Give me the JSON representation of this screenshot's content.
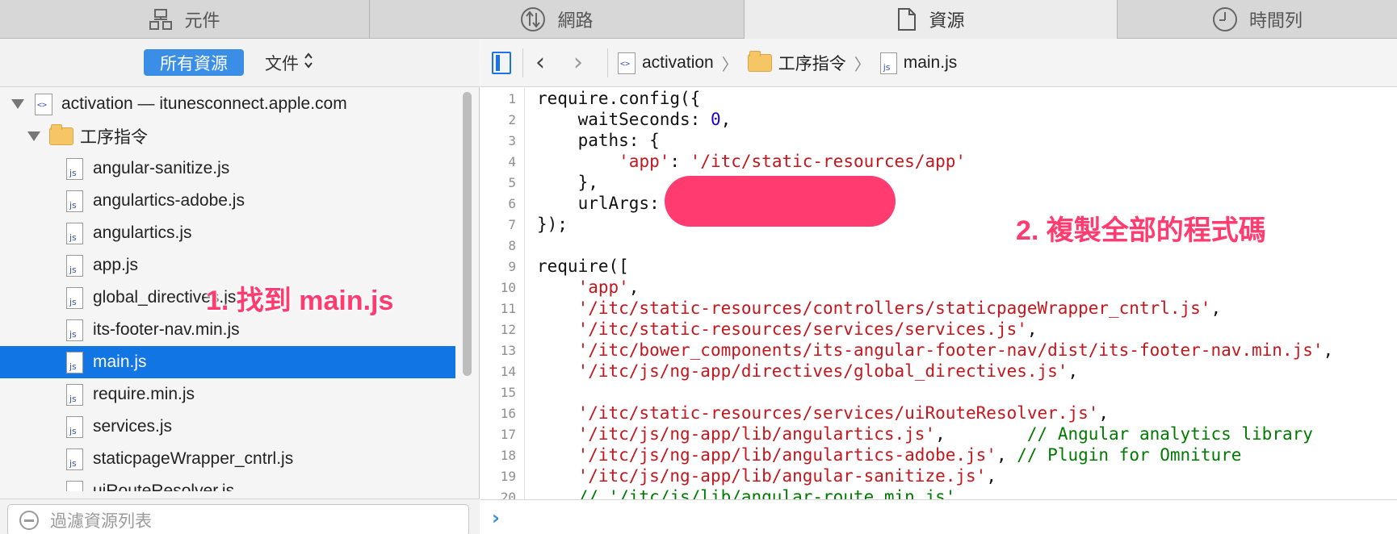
{
  "tabs": [
    {
      "label": "元件",
      "icon": "elements-icon"
    },
    {
      "label": "網路",
      "icon": "network-icon"
    },
    {
      "label": "資源",
      "icon": "resources-icon"
    },
    {
      "label": "時間列",
      "icon": "timelines-icon"
    }
  ],
  "sidebar": {
    "all_resources_label": "所有資源",
    "documents_label": "文件",
    "tree": {
      "root": "activation — itunesconnect.apple.com",
      "folder": "工序指令",
      "files": [
        "angular-sanitize.js",
        "angulartics-adobe.js",
        "angulartics.js",
        "app.js",
        "global_directives.js",
        "its-footer-nav.min.js",
        "main.js",
        "require.min.js",
        "services.js",
        "staticpageWrapper_cntrl.js",
        "uiRouteResolver.js"
      ],
      "file_icon_text": "js",
      "doc_icon_text": "<>"
    },
    "filter_placeholder": "過濾資源列表"
  },
  "editor": {
    "breadcrumb": [
      "activation",
      "工序指令",
      "main.js"
    ],
    "nav_back": "‹",
    "nav_forward": "›",
    "breadcrumb_sep": "〉",
    "console_prompt": "›",
    "code_lines": [
      {
        "n": "1",
        "parts": [
          {
            "t": "require.config({",
            "c": ""
          }
        ]
      },
      {
        "n": "2",
        "parts": [
          {
            "t": "    waitSeconds: ",
            "c": ""
          },
          {
            "t": "0",
            "c": "num"
          },
          {
            "t": ",",
            "c": ""
          }
        ]
      },
      {
        "n": "3",
        "parts": [
          {
            "t": "    paths: {",
            "c": ""
          }
        ]
      },
      {
        "n": "4",
        "parts": [
          {
            "t": "        ",
            "c": ""
          },
          {
            "t": "'app'",
            "c": "str"
          },
          {
            "t": ": ",
            "c": ""
          },
          {
            "t": "'/itc/static-resources/app'",
            "c": "str"
          }
        ]
      },
      {
        "n": "5",
        "parts": [
          {
            "t": "    },",
            "c": ""
          }
        ]
      },
      {
        "n": "6",
        "parts": [
          {
            "t": "    urlArgs:",
            "c": ""
          }
        ]
      },
      {
        "n": "7",
        "parts": [
          {
            "t": "});",
            "c": ""
          }
        ]
      },
      {
        "n": "8",
        "parts": [
          {
            "t": "",
            "c": ""
          }
        ]
      },
      {
        "n": "9",
        "parts": [
          {
            "t": "require([",
            "c": ""
          }
        ]
      },
      {
        "n": "10",
        "parts": [
          {
            "t": "    ",
            "c": ""
          },
          {
            "t": "'app'",
            "c": "str"
          },
          {
            "t": ",",
            "c": ""
          }
        ]
      },
      {
        "n": "11",
        "parts": [
          {
            "t": "    ",
            "c": ""
          },
          {
            "t": "'/itc/static-resources/controllers/staticpageWrapper_cntrl.js'",
            "c": "str"
          },
          {
            "t": ",",
            "c": ""
          }
        ]
      },
      {
        "n": "12",
        "parts": [
          {
            "t": "    ",
            "c": ""
          },
          {
            "t": "'/itc/static-resources/services/services.js'",
            "c": "str"
          },
          {
            "t": ",",
            "c": ""
          }
        ]
      },
      {
        "n": "13",
        "parts": [
          {
            "t": "    ",
            "c": ""
          },
          {
            "t": "'/itc/bower_components/its-angular-footer-nav/dist/its-footer-nav.min.js'",
            "c": "str"
          },
          {
            "t": ",",
            "c": ""
          }
        ]
      },
      {
        "n": "14",
        "parts": [
          {
            "t": "    ",
            "c": ""
          },
          {
            "t": "'/itc/js/ng-app/directives/global_directives.js'",
            "c": "str"
          },
          {
            "t": ",",
            "c": ""
          }
        ]
      },
      {
        "n": "15",
        "parts": [
          {
            "t": "",
            "c": ""
          }
        ]
      },
      {
        "n": "16",
        "parts": [
          {
            "t": "    ",
            "c": ""
          },
          {
            "t": "'/itc/static-resources/services/uiRouteResolver.js'",
            "c": "str"
          },
          {
            "t": ",",
            "c": ""
          }
        ]
      },
      {
        "n": "17",
        "parts": [
          {
            "t": "    ",
            "c": ""
          },
          {
            "t": "'/itc/js/ng-app/lib/angulartics.js'",
            "c": "str"
          },
          {
            "t": ",        ",
            "c": ""
          },
          {
            "t": "// Angular analytics library",
            "c": "com"
          }
        ]
      },
      {
        "n": "18",
        "parts": [
          {
            "t": "    ",
            "c": ""
          },
          {
            "t": "'/itc/js/ng-app/lib/angulartics-adobe.js'",
            "c": "str"
          },
          {
            "t": ", ",
            "c": ""
          },
          {
            "t": "// Plugin for Omniture",
            "c": "com"
          }
        ]
      },
      {
        "n": "19",
        "parts": [
          {
            "t": "    ",
            "c": ""
          },
          {
            "t": "'/itc/js/ng-app/lib/angular-sanitize.js'",
            "c": "str"
          },
          {
            "t": ",",
            "c": ""
          }
        ]
      },
      {
        "n": "20",
        "parts": [
          {
            "t": "    ",
            "c": ""
          },
          {
            "t": "// '/itc/js/lib/angular-route.min.js',",
            "c": "com"
          }
        ]
      }
    ]
  },
  "annotations": {
    "step1": "1. 找到 main.js",
    "step2": "2. 複製全部的程式碼"
  },
  "colors": {
    "annotation": "#ff3b6f",
    "selection": "#1175e4",
    "string": "#c4161c",
    "number": "#1c00cf",
    "comment": "#007a00"
  }
}
